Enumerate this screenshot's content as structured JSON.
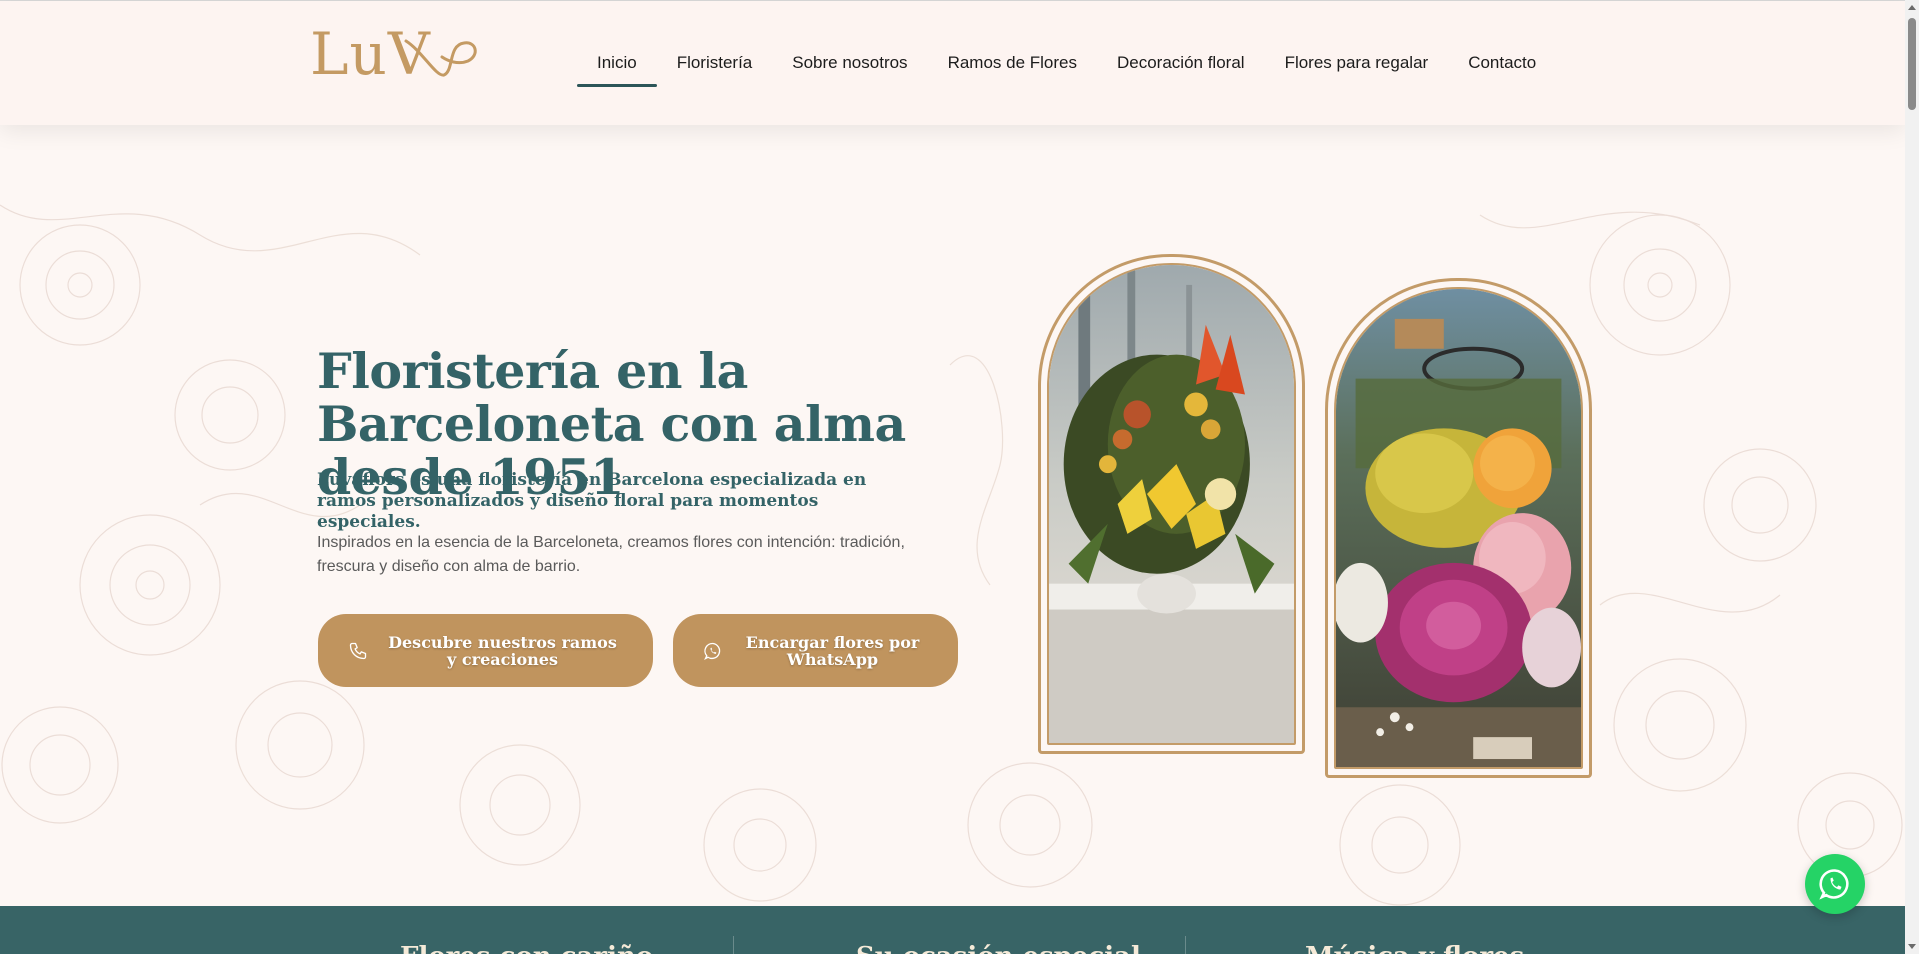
{
  "header": {
    "logo_text": "LuV",
    "nav": [
      {
        "label": "Inicio",
        "active": true
      },
      {
        "label": "Floristería",
        "active": false
      },
      {
        "label": "Sobre nosotros",
        "active": false
      },
      {
        "label": "Ramos de Flores",
        "active": false
      },
      {
        "label": "Decoración floral",
        "active": false
      },
      {
        "label": "Flores para regalar",
        "active": false
      },
      {
        "label": "Contacto",
        "active": false
      }
    ]
  },
  "hero": {
    "title": "Floristería en la Barceloneta con alma desde 1951",
    "subtitle": "Luvaflors es una floristería en Barcelona especializada en ramos personalizados y diseño floral para momentos especiales.",
    "description": "Inspirados en la esencia de la Barceloneta, creamos flores con intención: tradición, frescura y diseño con alma de barrio.",
    "button_primary": {
      "label": "Descubre nuestros ramos y creaciones",
      "icon": "phone-icon"
    },
    "button_secondary": {
      "label": "Encargar flores por WhatsApp",
      "icon": "whatsapp-icon"
    },
    "images": [
      {
        "name": "bouquet-lilies-image"
      },
      {
        "name": "bouquet-roses-image"
      }
    ]
  },
  "band": {
    "columns": [
      "Flores con cariño",
      "Su ocasión especial",
      "Música y flores"
    ]
  },
  "colors": {
    "teal": "#346367",
    "gold": "#c0945e",
    "background": "#fdf7f4",
    "whatsapp": "#25d366"
  },
  "float": {
    "icon": "whatsapp-icon"
  }
}
